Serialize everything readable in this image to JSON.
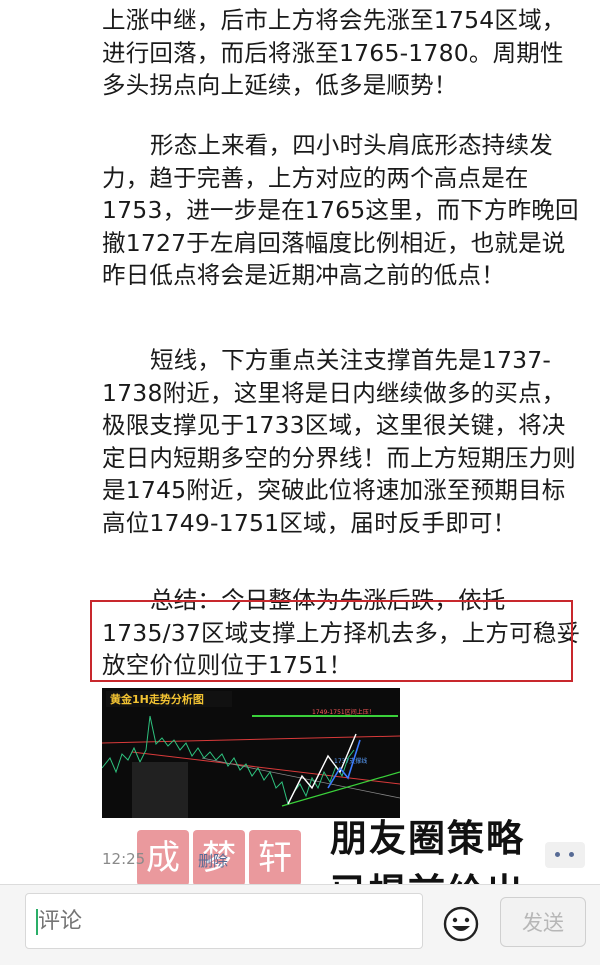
{
  "post": {
    "paragraphs": [
      "上涨中继，后市上方将会先涨至1754区域，进行回落，而后将涨至1765-1780。周期性多头拐点向上延续，低多是顺势！",
      "形态上来看，四小时头肩底形态持续发力，趋于完善，上方对应的两个高点是在1753，进一步是在1765这里，而下方昨晚回撤1727于左肩回落幅度比例相近，也就是说昨日低点将会是近期冲高之前的低点！",
      "短线，下方重点关注支撑首先是1737-1738附近，这里将是日内继续做多的买点，极限支撑见于1733区域，这里很关键，将决定日内短期多空的分界线！而上方短期压力则是1745附近，突破此位将速加涨至预期目标高位1749-1751区域，届时反手即可！",
      "总结：今日整体为先涨后跌，依托1735/37区域支撑上方择机去多，上方可稳妥放空价位则位于1751！"
    ],
    "chart_thumbnail": {
      "title": "黄金1H走势分析图",
      "label_top": "1749-1751区间上压！",
      "label_mid": "1737支撑线"
    },
    "time": "12:25",
    "delete_label": "删除"
  },
  "watermark_stamp": [
    "成",
    "梦",
    "轩"
  ],
  "overlay_caption": "朋友圈策略已提前给出",
  "colors": {
    "highlight_border": "#c8282d",
    "link": "#576b95",
    "caret": "#2aae67"
  },
  "input_bar": {
    "placeholder": "评论",
    "emoji_icon": "smiley-icon",
    "send_label": "发送"
  }
}
